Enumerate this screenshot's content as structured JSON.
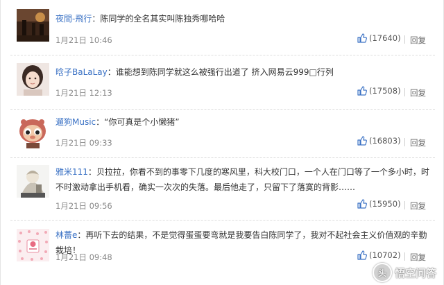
{
  "comments": [
    {
      "user": "夜間-飛行",
      "sep": "：",
      "text": "陈同学的全名其实叫陈独秀哪哈哈",
      "time": "1月21日 10:46",
      "likes": "(17640)",
      "reply": "回复"
    },
    {
      "user": "晗子BaLaLay",
      "sep": "：",
      "text": "谁能想到陈同学就这么被强行出道了 挤入网易云999□行列",
      "time": "1月21日 12:13",
      "likes": "(17508)",
      "reply": "回复"
    },
    {
      "user": "遛狗Music",
      "sep": "：",
      "text": "“你可真是个小懒猪”",
      "time": "1月21日 09:33",
      "likes": "(16803)",
      "reply": "回复"
    },
    {
      "user": "雅米111",
      "sep": "：",
      "text": "贝拉拉，你看不到的事零下几度的寒风里，科大校门口，一个人在门口等了一个多小时，时不时激动拿出手机看，确实一次次的失落。最后他走了，只留下了落寞的背影……",
      "time": "1月21日 09:56",
      "likes": "(15950)",
      "reply": "回复"
    },
    {
      "user": "林薔e",
      "sep": "：",
      "text": "再听下去的结果，不是觉得蛋蛋要弯就是我要告白陈同学了，我对不起社会主义价值观的辛勤栽培！",
      "time": "1月21日 09:48",
      "likes": "(10702)",
      "reply": "回复"
    }
  ],
  "watermark": {
    "text": "悟空问答",
    "logo_glyph": "头"
  },
  "icons": {
    "like": "thumbs-up-icon"
  },
  "colors": {
    "username": "#3a71c4",
    "like_icon": "#3a71c4",
    "meta": "#888888"
  }
}
